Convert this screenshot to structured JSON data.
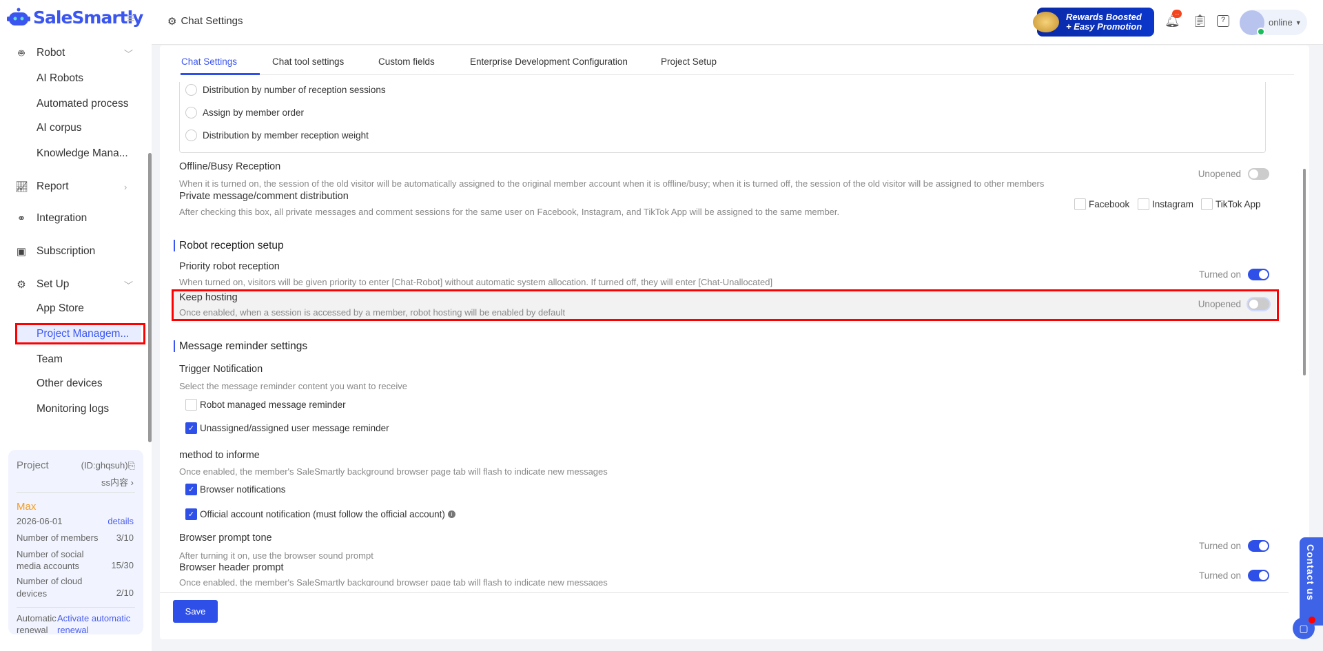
{
  "app": {
    "logo": "SaleSmartly",
    "page_title": "Chat Settings"
  },
  "header": {
    "promo_line1": "Rewards Boosted",
    "promo_line2": "+ Easy Promotion",
    "notification_badge": "...",
    "status": "online"
  },
  "sidebar": {
    "items": [
      {
        "label": "Robot",
        "icon": "robot-icon",
        "group": true
      },
      {
        "label": "AI Robots"
      },
      {
        "label": "Automated process"
      },
      {
        "label": "AI corpus"
      },
      {
        "label": "Knowledge Mana..."
      },
      {
        "label": "Report",
        "icon": "chart-icon",
        "group": true
      },
      {
        "label": "Integration",
        "icon": "integration-icon",
        "group": true
      },
      {
        "label": "Subscription",
        "icon": "wallet-icon",
        "group": true
      },
      {
        "label": "Set Up",
        "icon": "gear-icon",
        "group": true
      },
      {
        "label": "App Store"
      },
      {
        "label": "Project Managem..."
      },
      {
        "label": "Team"
      },
      {
        "label": "Other devices"
      },
      {
        "label": "Monitoring logs"
      }
    ]
  },
  "project": {
    "label": "Project",
    "id": "(ID:ghqsuh)",
    "name": "ss内容",
    "plan": "Max",
    "date": "2026-06-01",
    "details": "details",
    "members_label": "Number of members",
    "members": "3/10",
    "social_label": "Number of social media accounts",
    "social": "15/30",
    "cloud_label": "Number of cloud devices",
    "cloud": "2/10",
    "renewal_label": "Automatic renewal",
    "renewal_link": "Activate automatic renewal"
  },
  "tabs": [
    "Chat Settings",
    "Chat tool settings",
    "Custom fields",
    "Enterprise Development Configuration",
    "Project Setup"
  ],
  "radios": [
    "Distribution by number of reception sessions",
    "Assign by member order",
    "Distribution by member reception weight"
  ],
  "offline": {
    "title": "Offline/Busy Reception",
    "desc": "When it is turned on, the session of the old visitor will be automatically assigned to the original member account when it is offline/busy; when it is turned off, the session of the old visitor will be assigned to other members",
    "state": "Unopened"
  },
  "private": {
    "title": "Private message/comment distribution",
    "desc": "After checking this box, all private messages and comment sessions for the same user on Facebook, Instagram, and TikTok App will be assigned to the same member.",
    "options": [
      "Facebook",
      "Instagram",
      "TikTok App"
    ]
  },
  "robot_section": "Robot reception setup",
  "priority": {
    "title": "Priority robot reception",
    "desc": "When turned on, visitors will be given priority to enter [Chat-Robot] without automatic system allocation. If turned off, they will enter [Chat-Unallocated]",
    "state": "Turned on"
  },
  "keep": {
    "title": "Keep hosting",
    "desc": "Once enabled, when a session is accessed by a member, robot hosting will be enabled by default",
    "state": "Unopened"
  },
  "reminder_section": "Message reminder settings",
  "trigger": {
    "title": "Trigger Notification",
    "desc": "Select the message reminder content you want to receive",
    "options": [
      "Robot managed message reminder",
      "Unassigned/assigned user message reminder"
    ]
  },
  "method": {
    "title": "method to informe",
    "desc": "Once enabled, the member's SaleSmartly background browser page tab will flash to indicate new messages",
    "options": [
      "Browser notifications",
      "Official account notification (must follow the official account)"
    ]
  },
  "tone": {
    "title": "Browser prompt tone",
    "desc": "After turning it on, use the browser sound prompt",
    "state": "Turned on"
  },
  "headerprompt": {
    "title": "Browser header prompt",
    "desc": "Once enabled, the member's SaleSmartly background browser page tab will flash to indicate new messages",
    "state": "Turned on"
  },
  "save": "Save",
  "contact": "Contact us"
}
